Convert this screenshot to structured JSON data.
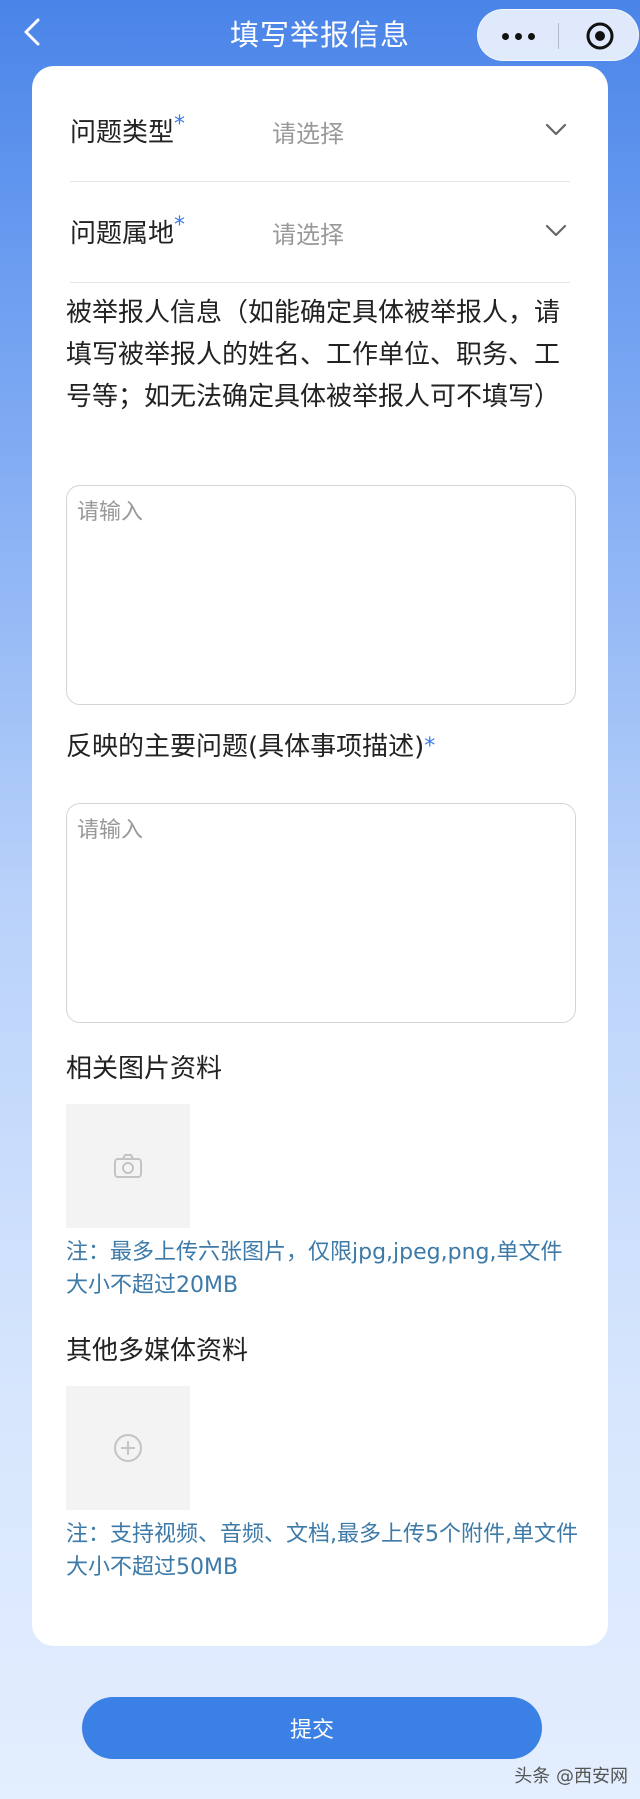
{
  "header": {
    "title": "填写举报信息"
  },
  "form": {
    "issue_type": {
      "label": "问题类型",
      "required_mark": "*",
      "value": "请选择"
    },
    "issue_location": {
      "label": "问题属地",
      "required_mark": "*",
      "value": "请选择"
    },
    "reported_person": {
      "label": "被举报人信息（如能确定具体被举报人，请填写被举报人的姓名、工作单位、职务、工号等；如无法确定具体被举报人可不填写）",
      "placeholder": "请输入"
    },
    "main_issue": {
      "label": "反映的主要问题(具体事项描述)",
      "required_mark": "*",
      "placeholder": "请输入"
    },
    "images": {
      "label": "相关图片资料",
      "note": "注：最多上传六张图片，仅限jpg,jpeg,png,单文件大小不超过20MB"
    },
    "media": {
      "label": "其他多媒体资料",
      "note": "注：支持视频、音频、文档,最多上传5个附件,单文件大小不超过50MB"
    }
  },
  "submit_label": "提交",
  "watermark": "头条 @西安网",
  "colors": {
    "accent": "#3b80e4",
    "required": "#3a7ae6",
    "note": "#3d7aa8"
  }
}
